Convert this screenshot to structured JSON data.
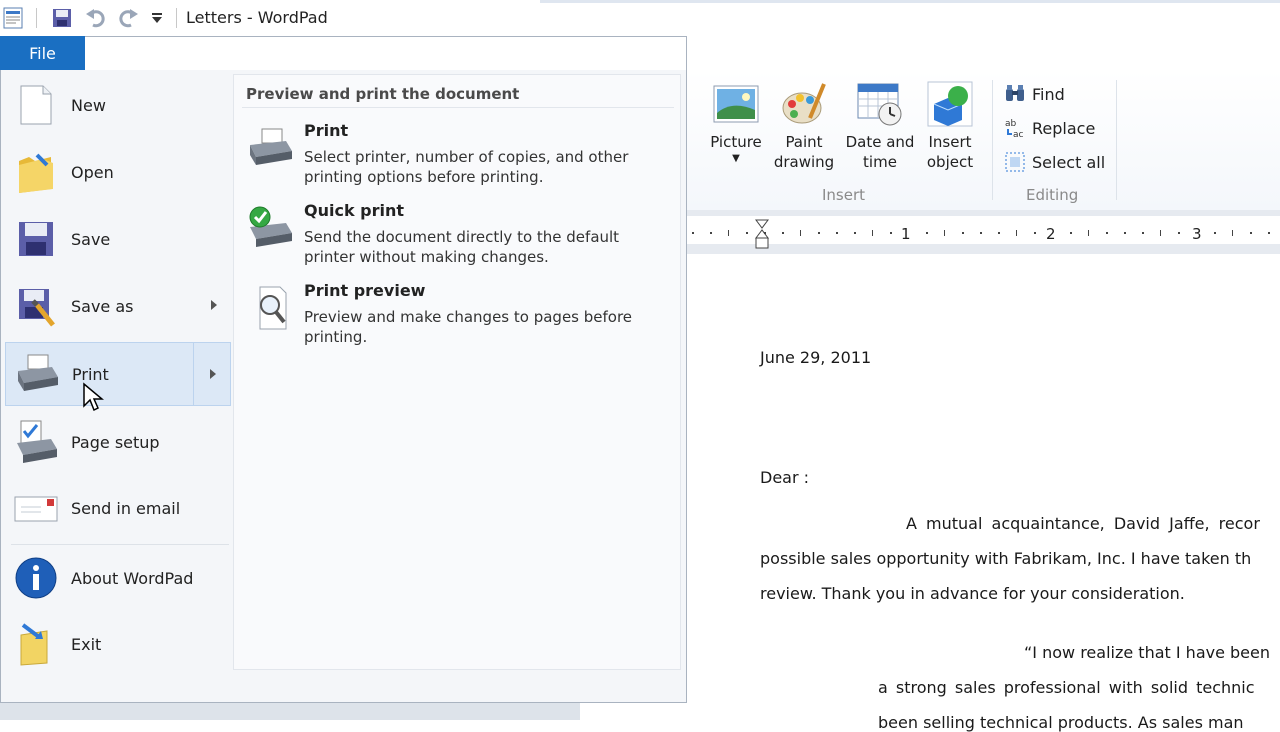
{
  "window": {
    "title": "Letters - WordPad"
  },
  "file_tab": {
    "label": "File"
  },
  "file_menu": {
    "items": [
      {
        "label": "New"
      },
      {
        "label": "Open"
      },
      {
        "label": "Save"
      },
      {
        "label": "Save as"
      },
      {
        "label": "Print"
      },
      {
        "label": "Page setup"
      },
      {
        "label": "Send in email"
      },
      {
        "label": "About WordPad"
      },
      {
        "label": "Exit"
      }
    ],
    "print_panel": {
      "heading": "Preview and print the document",
      "options": [
        {
          "title": "Print",
          "line1": "Select printer, number of copies, and other",
          "line2": "printing options before printing."
        },
        {
          "title": "Quick print",
          "line1": "Send the document directly to the default",
          "line2": "printer without making changes."
        },
        {
          "title": "Print preview",
          "line1": "Preview and make changes to pages before",
          "line2": "printing."
        }
      ]
    }
  },
  "ribbon": {
    "insert": {
      "picture": "Picture",
      "paint_1": "Paint",
      "paint_2": "drawing",
      "date_1": "Date and",
      "date_2": "time",
      "object_1": "Insert",
      "object_2": "object",
      "group_label": "Insert"
    },
    "editing": {
      "find": "Find",
      "replace": "Replace",
      "select_all": "Select all",
      "group_label": "Editing"
    }
  },
  "ruler": {
    "n1": "1",
    "n2": "2",
    "n3": "3"
  },
  "document": {
    "date": "June 29, 2011",
    "salutation": "Dear :",
    "p1_l1": "A mutual acquaintance, David Jaffe, recor",
    "p1_l2": "possible sales opportunity with Fabrikam, Inc. I have taken th",
    "p1_l3": "review. Thank you in advance for your consideration.",
    "q_l1": "“I now realize that I have been",
    "q_l2": "a strong sales professional with solid technic",
    "q_l3": "been selling technical products. As sales man"
  }
}
